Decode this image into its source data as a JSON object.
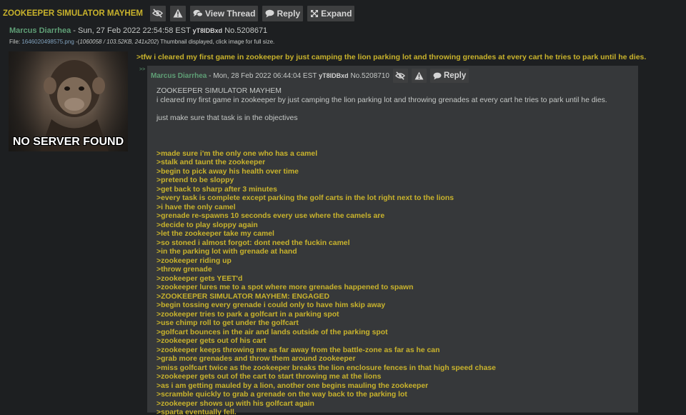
{
  "thread": {
    "subject": "ZOOKEEPER SIMULATOR MAYHEM",
    "buttons": {
      "view_thread": "View Thread",
      "reply": "Reply",
      "expand": "Expand"
    }
  },
  "op": {
    "name": "Marcus Diarrhea",
    "datetime": "- Sun, 27 Feb 2022 22:54:58 EST",
    "poster_id": "yT8IDBxd",
    "post_no": "No.5208671",
    "file_prefix": "File:",
    "file_name": "1646020498575.png",
    "file_meta_open": "-(",
    "file_meta": "1060058 / 103.52KB, 241x202",
    "file_meta_close": ")",
    "file_note": "Thumbnail displayed, click image for full size.",
    "image_caption": "NO SERVER FOUND",
    "comment": ">tfw i cleared my first game in zookeeper by just camping the lion parking lot and throwing grenades at every cart he tries to park until he dies."
  },
  "reply": {
    "arrows": ">>",
    "name": "Marcus Diarrhea",
    "datetime": "- Mon, 28 Feb 2022 06:44:04 EST",
    "poster_id": "yT8IDBxd",
    "post_no": "No.5208710",
    "reply_label": "Reply",
    "plain_lines": [
      "ZOOKEEPER SIMULATOR MAYHEM",
      "i cleared my first game in zookeeper by just camping the lion parking lot and throwing grenades at every cart he tries to park until he dies.",
      "",
      "just make sure that task is in the objectives",
      "",
      "",
      ""
    ],
    "greentext_lines": [
      ">made sure i'm the only one who has a camel",
      ">stalk and taunt the zookeeper",
      ">begin to pick away his health over time",
      ">pretend to be sloppy",
      ">get back to sharp after 3 minutes",
      ">every task is complete except parking the golf carts in the lot right next to the lions",
      ">i have the only camel",
      ">grenade re-spawns 10 seconds every use where the camels are",
      ">decide to play sloppy again",
      ">let the zookeeper take my camel",
      ">so stoned i almost forgot: dont need the fuckin camel",
      ">in the parking lot with grenade at hand",
      ">zookeeper riding up",
      ">throw grenade",
      ">zookeeper gets YEET'd",
      ">zookeeper lures me to a spot where more grenades happened to spawn",
      ">ZOOKEEPER SIMULATOR MAYHEM: ENGAGED",
      ">begin tossing every grenade i could only to have him skip away",
      ">zookeeper tries to park a golfcart in a parking spot",
      ">use chimp roll to get under the golfcart",
      ">golfcart bounces in the air and lands outside of the parking spot",
      ">zookeeper gets out of his cart",
      ">zookeeper keeps throwing me as far away from the battle-zone as far as he can",
      ">grab more grenades and throw them around zookeeper",
      ">miss golfcart twice as the zookeeper breaks the lion enclosure fences in that high speed chase",
      ">zookeeper gets out of the cart to start throwing me at the lions",
      ">as i am getting mauled by a lion, another one begins mauling the zookeeper",
      ">scramble quickly to grab a grenade on the way back to the parking lot",
      ">zookeeper shows up with his golfcart again",
      ">sparta eventually fell."
    ]
  },
  "icons": {
    "hide": "eye-slash-icon",
    "report": "warning-icon",
    "view_thread": "comments-icon",
    "reply": "comment-icon",
    "expand": "expand-icon"
  },
  "colors": {
    "background": "#1d1f21",
    "reply_background": "#36383a",
    "subject": "#c9b32c",
    "greentext": "#c9b32c",
    "name": "#5f9f76",
    "button": "#3e3f40"
  }
}
